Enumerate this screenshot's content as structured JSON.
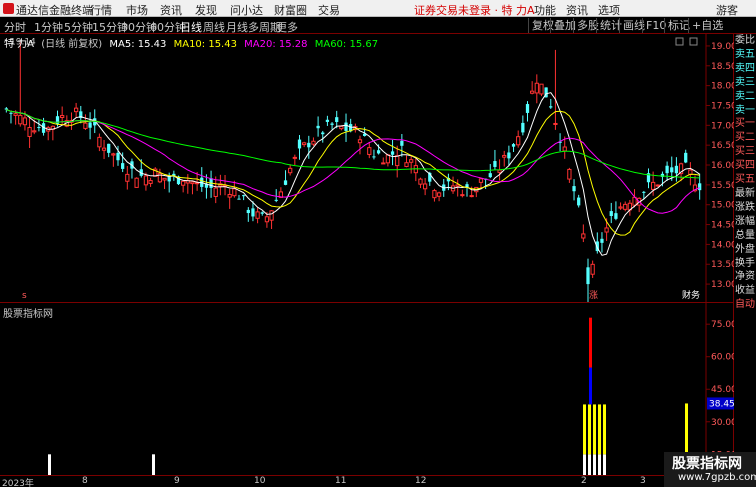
{
  "menubar": {
    "app_title": "通达信金融终端",
    "items": [
      "行情",
      "市场",
      "资讯",
      "发现",
      "问小达",
      "财富圈",
      "交易"
    ],
    "notice": "证券交易未登录 · 特 力A",
    "right_items": [
      "功能",
      "资讯",
      "选项"
    ],
    "user": "游客"
  },
  "toolbar": {
    "periods": [
      "分时",
      "1分钟",
      "5分钟",
      "15分钟",
      "30分钟",
      "60分钟",
      "日线",
      "周线",
      "月线",
      "多周期",
      "更多"
    ],
    "active_period": "日线",
    "buttons": [
      "复权",
      "叠加",
      "多股",
      "统计",
      "画线",
      "F10",
      "标记",
      "+自选"
    ]
  },
  "legend": {
    "stock": "特 力A",
    "adjust": "(日线 前复权)",
    "ma5": "MA5: 15.43",
    "ma10": "MA10: 15.43",
    "ma20": "MA20: 15.28",
    "ma60": "MA60: 15.67"
  },
  "price_axis": {
    "ticks": [
      "19.00",
      "18.50",
      "18.00",
      "17.50",
      "17.00",
      "16.50",
      "16.00",
      "15.50",
      "15.00",
      "14.50",
      "14.00",
      "13.50",
      "13.00"
    ],
    "range": [
      12.7,
      19.2
    ]
  },
  "annotations": {
    "high": "19.14",
    "low": "12.24",
    "mark_low": "涨",
    "mark_left": "s",
    "badge": "财务"
  },
  "indicator": {
    "title": "股票指标网",
    "ticks": [
      "75.00",
      "60.00",
      "45.00",
      "30.00",
      "15.00"
    ],
    "current_value": "38.45",
    "range": [
      5,
      82
    ]
  },
  "xaxis": {
    "labels": [
      "2023年",
      "8",
      "9",
      "10",
      "11",
      "12",
      "2",
      "3"
    ]
  },
  "side_panel": {
    "items": [
      "委比",
      "卖五",
      "卖四",
      "卖三",
      "卖二",
      "卖一",
      "买一",
      "买二",
      "买三",
      "买四",
      "买五",
      "最新",
      "涨跌",
      "涨幅",
      "总量",
      "外盘",
      "换手",
      "净资",
      "收益",
      "自动"
    ]
  },
  "watermark": {
    "title": "股票指标网",
    "url": "www.7gpzb.com"
  },
  "colors": {
    "up": "#ff3232",
    "down": "#54ffff",
    "ma5": "#ffffff",
    "ma10": "#ffff00",
    "ma20": "#ff00ff",
    "ma60": "#00ff00",
    "frame": "#7a0000"
  },
  "chart_data": {
    "type": "candlestick",
    "ma_periods": [
      5,
      10,
      20,
      60
    ],
    "close_path": [
      17.4,
      17.2,
      17.0,
      16.9,
      17.2,
      17.3,
      17.1,
      16.6,
      16.2,
      15.9,
      15.7,
      15.8,
      15.6,
      15.7,
      15.5,
      15.4,
      15.5,
      15.3,
      14.8,
      14.6,
      15.2,
      16.0,
      16.5,
      16.8,
      17.0,
      16.9,
      16.8,
      16.3,
      16.2,
      16.4,
      16.0,
      15.6,
      15.4,
      15.5,
      15.3,
      15.6,
      15.8,
      16.3,
      17.0,
      18.2,
      17.6,
      16.4,
      15.0,
      13.2,
      14.3,
      14.9,
      15.2,
      15.4,
      15.6,
      15.8,
      15.9,
      15.5
    ],
    "indicator_bars": [
      {
        "x_label": "8",
        "value": 15,
        "color": "white"
      },
      {
        "x_label": "9",
        "value": 15,
        "color": "white"
      },
      {
        "x_label": "2",
        "value": 78,
        "color": "mixed"
      },
      {
        "x_label": "3",
        "value": 38.45,
        "color": "yellow"
      }
    ]
  }
}
